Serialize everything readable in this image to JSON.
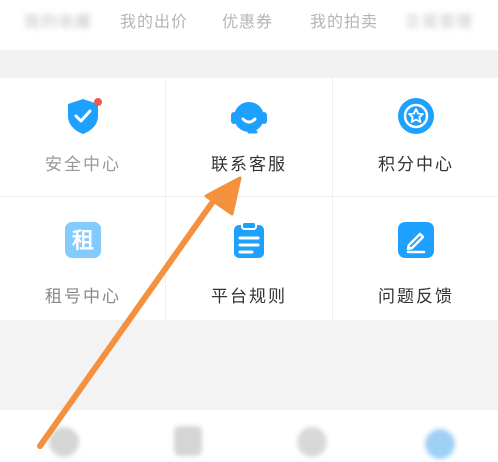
{
  "top_tabs": [
    {
      "label": "我的收藏"
    },
    {
      "label": "我的出价"
    },
    {
      "label": "优惠券"
    },
    {
      "label": "我的拍卖"
    },
    {
      "label": "交易管理"
    }
  ],
  "services": [
    {
      "label": "安全中心",
      "icon": "shield-check-icon",
      "badge": true
    },
    {
      "label": "联系客服",
      "icon": "headset-icon"
    },
    {
      "label": "积分中心",
      "icon": "star-badge-icon"
    },
    {
      "label": "租号中心",
      "icon": "rent-icon",
      "icon_text": "租"
    },
    {
      "label": "平台规则",
      "icon": "clipboard-icon"
    },
    {
      "label": "问题反馈",
      "icon": "edit-icon"
    }
  ],
  "colors": {
    "accent": "#1ea0ff",
    "badge": "#f05a4a",
    "annotation_arrow": "#f4913f"
  },
  "bottom_nav": [
    {
      "icon": "home-icon"
    },
    {
      "icon": "category-icon"
    },
    {
      "icon": "message-icon"
    },
    {
      "icon": "profile-icon"
    }
  ]
}
